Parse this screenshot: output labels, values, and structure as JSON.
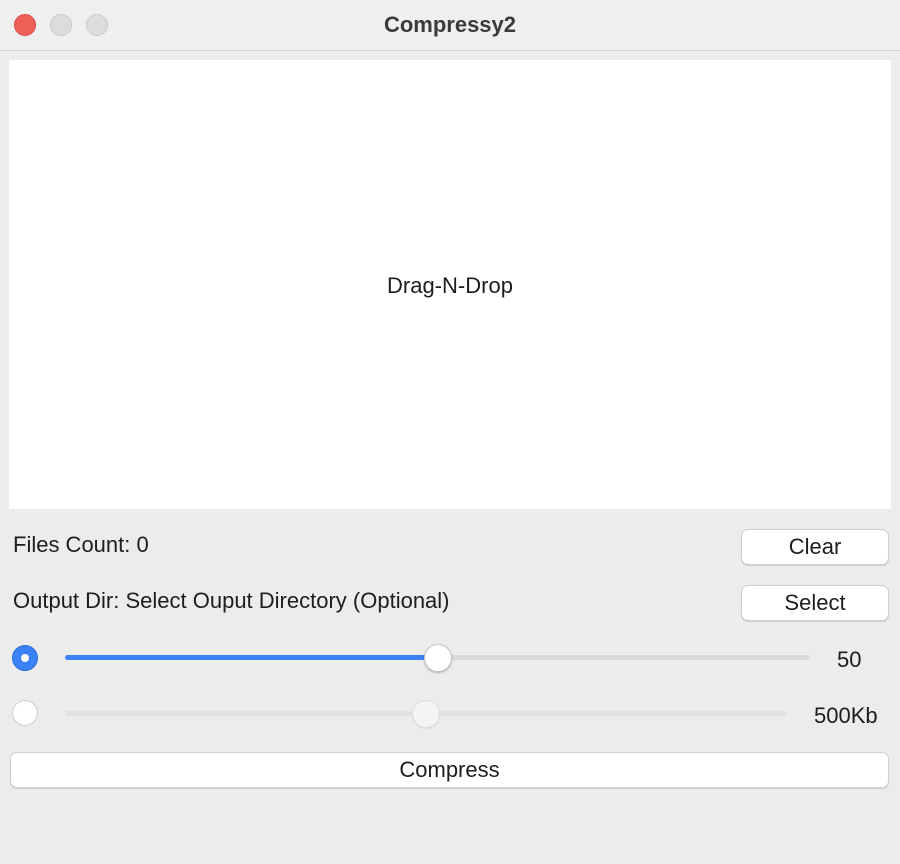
{
  "window": {
    "title": "Compressy2"
  },
  "drop_zone": {
    "label": "Drag-N-Drop"
  },
  "files": {
    "count_label": "Files Count: 0",
    "clear_label": "Clear"
  },
  "output": {
    "dir_label": "Output Dir: Select Ouput Directory (Optional)",
    "select_label": "Select"
  },
  "quality": {
    "selected": true,
    "value": 50,
    "value_text": "50",
    "fraction": 0.5
  },
  "size": {
    "selected": false,
    "value_text": "500Kb",
    "fraction": 0.5
  },
  "compress_label": "Compress",
  "colors": {
    "accent": "#3b82f6",
    "close": "#ee5f58",
    "background": "#ececec"
  }
}
